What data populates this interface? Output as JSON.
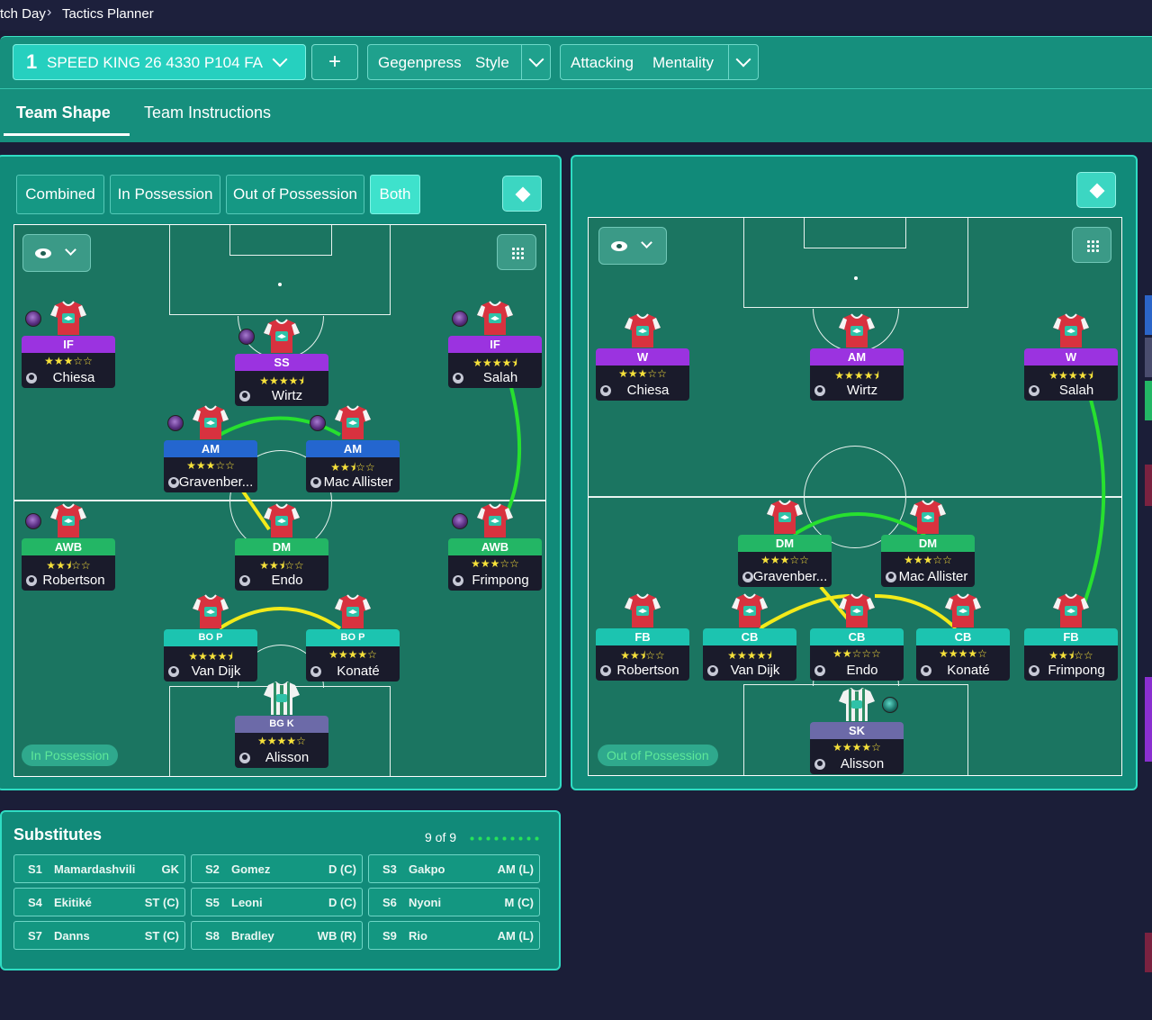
{
  "breadcrumb": {
    "parent": "tch Day",
    "current": "Tactics Planner"
  },
  "header": {
    "tactic_number": "1",
    "tactic_name": "SPEED KING 26 4330 P104 FA",
    "add_label": "+",
    "style_value": "Gegenpress",
    "style_label": "Style",
    "mentality_value": "Attacking",
    "mentality_label": "Mentality"
  },
  "tabs": [
    "Team Shape",
    "Team Instructions"
  ],
  "view_modes": [
    "Combined",
    "In Possession",
    "Out of Possession",
    "Both"
  ],
  "active_view_mode": "Both",
  "left_pitch": {
    "mode_label": "In Possession",
    "players": [
      {
        "role": "IF",
        "stars": "★★★☆☆",
        "name": "Chiesa",
        "group": "att"
      },
      {
        "role": "SS",
        "stars": "★★★★⯨",
        "name": "Wirtz",
        "group": "att"
      },
      {
        "role": "IF",
        "stars": "★★★★⯨",
        "name": "Salah",
        "group": "att"
      },
      {
        "role": "AM",
        "stars": "★★★☆☆",
        "name": "Gravenber...",
        "group": "am"
      },
      {
        "role": "AM",
        "stars": "★★⯨☆☆",
        "name": "Mac Allister",
        "group": "am"
      },
      {
        "role": "AWB",
        "stars": "★★⯨☆☆",
        "name": "Robertson",
        "group": "dm"
      },
      {
        "role": "DM",
        "stars": "★★⯨☆☆",
        "name": "Endo",
        "group": "dm"
      },
      {
        "role": "AWB",
        "stars": "★★★☆☆",
        "name": "Frimpong",
        "group": "dm"
      },
      {
        "role": "BO\nP",
        "stars": "★★★★⯨",
        "name": "Van Dijk",
        "group": "def"
      },
      {
        "role": "BO\nP",
        "stars": "★★★★☆",
        "name": "Konaté",
        "group": "def"
      },
      {
        "role": "BG\nK",
        "stars": "★★★★☆",
        "name": "Alisson",
        "group": "gk"
      }
    ]
  },
  "right_pitch": {
    "mode_label": "Out of Possession",
    "players": [
      {
        "role": "W",
        "stars": "★★★☆☆",
        "name": "Chiesa",
        "group": "att"
      },
      {
        "role": "AM",
        "stars": "★★★★⯨",
        "name": "Wirtz",
        "group": "att"
      },
      {
        "role": "W",
        "stars": "★★★★⯨",
        "name": "Salah",
        "group": "att"
      },
      {
        "role": "DM",
        "stars": "★★★☆☆",
        "name": "Gravenber...",
        "group": "dm"
      },
      {
        "role": "DM",
        "stars": "★★★☆☆",
        "name": "Mac Allister",
        "group": "dm"
      },
      {
        "role": "FB",
        "stars": "★★⯨☆☆",
        "name": "Robertson",
        "group": "def"
      },
      {
        "role": "CB",
        "stars": "★★★★⯨",
        "name": "Van Dijk",
        "group": "def"
      },
      {
        "role": "CB",
        "stars": "★★☆☆☆",
        "name": "Endo",
        "group": "def"
      },
      {
        "role": "CB",
        "stars": "★★★★☆",
        "name": "Konaté",
        "group": "def"
      },
      {
        "role": "FB",
        "stars": "★★⯨☆☆",
        "name": "Frimpong",
        "group": "def"
      },
      {
        "role": "SK",
        "stars": "★★★★☆",
        "name": "Alisson",
        "group": "gk"
      }
    ]
  },
  "substitutes": {
    "title": "Substitutes",
    "count": "9 of 9",
    "items": [
      {
        "slot": "S1",
        "name": "Mamardashvili",
        "pos": "GK"
      },
      {
        "slot": "S2",
        "name": "Gomez",
        "pos": "D (C)"
      },
      {
        "slot": "S3",
        "name": "Gakpo",
        "pos": "AM (L)"
      },
      {
        "slot": "S4",
        "name": "Ekitiké",
        "pos": "ST (C)"
      },
      {
        "slot": "S5",
        "name": "Leoni",
        "pos": "D (C)"
      },
      {
        "slot": "S6",
        "name": "Nyoni",
        "pos": "M (C)"
      },
      {
        "slot": "S7",
        "name": "Danns",
        "pos": "ST (C)"
      },
      {
        "slot": "S8",
        "name": "Bradley",
        "pos": "WB (R)"
      },
      {
        "slot": "S9",
        "name": "Rio",
        "pos": "AM (L)"
      }
    ]
  },
  "colors": {
    "background": "#1b1e38",
    "panel": "#118a79",
    "pitch": "#1b7561",
    "link_strong": "#27e02f",
    "link_medium": "#f2ea1a"
  }
}
